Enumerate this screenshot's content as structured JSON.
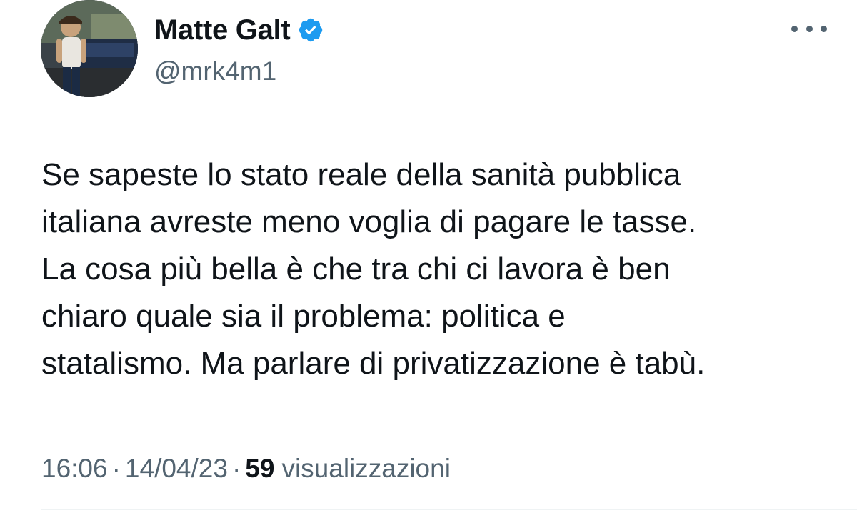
{
  "author": {
    "display_name": "Matte Galt",
    "handle": "@mrk4m1",
    "verified": true
  },
  "tweet": {
    "lines": [
      "Se sapeste lo stato reale della sanità pubblica",
      "italiana avreste meno voglia di pagare le tasse.",
      "La cosa più bella è che tra chi ci lavora è ben",
      "chiaro quale sia il problema: politica e",
      "statalismo. Ma parlare di privatizzazione è tabù."
    ]
  },
  "meta": {
    "time": "16:06",
    "separator": "·",
    "date": "14/04/23",
    "views_count": "59",
    "views_label": "visualizzazioni"
  },
  "icons": {
    "verified": "verified-badge-icon",
    "more": "more-options-icon"
  },
  "colors": {
    "text_primary": "#0f1419",
    "text_secondary": "#536471",
    "verified_blue": "#1d9bf0",
    "divider": "#eff3f4"
  }
}
